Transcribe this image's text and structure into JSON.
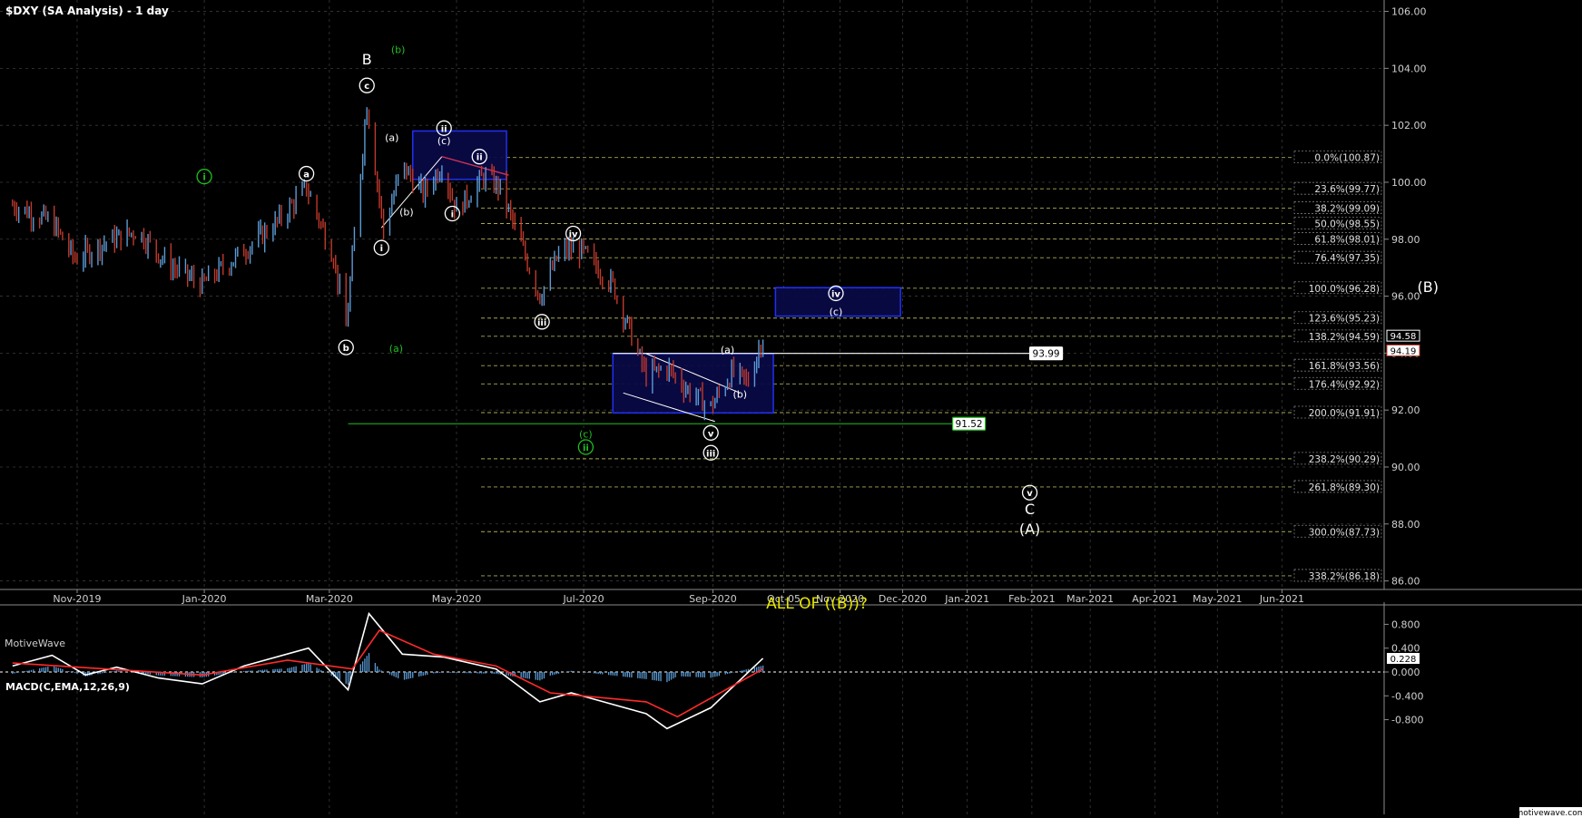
{
  "header": {
    "title": "$DXY (SA Analysis) - 1 day"
  },
  "watermark": "MotiveWave",
  "footer_brand": "motivewave.com",
  "colors": {
    "up": "#5b9bd5",
    "down": "#c0392b",
    "grid": "#3a3a3a",
    "fib": "#a9a957",
    "box_fill": "#0a0a45",
    "box_stroke": "#2233ff",
    "green": "#1fbf1f",
    "annotation": "#e6e600"
  },
  "chart_data": [
    {
      "type": "candlestick",
      "y_ticks": [
        "106.00",
        "104.00",
        "102.00",
        "100.00",
        "98.00",
        "96.00",
        "94.00",
        "92.00",
        "90.00",
        "88.00",
        "86.00"
      ],
      "x_labels": [
        "Nov-2019",
        "Jan-2020",
        "Mar-2020",
        "May-2020",
        "Jul-2020",
        "Sep-2020",
        "Oct-05",
        "Nov-2020",
        "Dec-2020",
        "Jan-2021",
        "Feb-2021",
        "Mar-2021",
        "Apr-2021",
        "May-2021",
        "Jun-2021"
      ],
      "ylim": [
        85.7,
        106.4
      ],
      "price_path": [
        [
          "2019-10-01",
          99.2
        ],
        [
          "2019-10-20",
          98.6
        ],
        [
          "2019-10-31",
          97.3
        ],
        [
          "2019-11-15",
          97.9
        ],
        [
          "2019-11-30",
          98.3
        ],
        [
          "2019-12-15",
          97.1
        ],
        [
          "2019-12-31",
          96.4
        ],
        [
          "2020-01-20",
          97.6
        ],
        [
          "2020-02-05",
          98.6
        ],
        [
          "2020-02-19",
          99.8
        ],
        [
          "2020-03-03",
          97.4
        ],
        [
          "2020-03-09",
          94.9
        ],
        [
          "2020-03-19",
          102.8
        ],
        [
          "2020-03-27",
          98.3
        ],
        [
          "2020-04-05",
          100.6
        ],
        [
          "2020-04-15",
          99.6
        ],
        [
          "2020-04-24",
          100.6
        ],
        [
          "2020-05-01",
          99.0
        ],
        [
          "2020-05-14",
          100.2
        ],
        [
          "2020-05-22",
          99.8
        ],
        [
          "2020-06-10",
          96.0
        ],
        [
          "2020-06-20",
          97.6
        ],
        [
          "2020-06-30",
          97.6
        ],
        [
          "2020-07-15",
          96.4
        ],
        [
          "2020-07-31",
          93.2
        ],
        [
          "2020-08-10",
          93.5
        ],
        [
          "2020-08-20",
          92.7
        ],
        [
          "2020-08-31",
          92.1
        ],
        [
          "2020-09-10",
          93.3
        ],
        [
          "2020-09-18",
          93.0
        ],
        [
          "2020-09-25",
          94.6
        ]
      ],
      "fib_levels": [
        {
          "label": "0.0%(100.87)",
          "price": 100.87
        },
        {
          "label": "23.6%(99.77)",
          "price": 99.77
        },
        {
          "label": "38.2%(99.09)",
          "price": 99.09
        },
        {
          "label": "50.0%(98.55)",
          "price": 98.55
        },
        {
          "label": "61.8%(98.01)",
          "price": 98.01
        },
        {
          "label": "76.4%(97.35)",
          "price": 97.35
        },
        {
          "label": "100.0%(96.28)",
          "price": 96.28
        },
        {
          "label": "123.6%(95.23)",
          "price": 95.23
        },
        {
          "label": "138.2%(94.59)",
          "price": 94.59
        },
        {
          "label": "161.8%(93.56)",
          "price": 93.56
        },
        {
          "label": "176.4%(92.92)",
          "price": 92.92
        },
        {
          "label": "200.0%(91.91)",
          "price": 91.91
        },
        {
          "label": "238.2%(90.29)",
          "price": 90.29
        },
        {
          "label": "261.8%(89.30)",
          "price": 89.3
        },
        {
          "label": "300.0%(87.73)",
          "price": 87.73
        },
        {
          "label": "338.2%(86.18)",
          "price": 86.18
        }
      ],
      "horizontal_lines": [
        {
          "label": "93.99",
          "price": 93.99,
          "start": "2020-07-15",
          "end": "2021-01-31"
        },
        {
          "label": "91.52",
          "price": 91.52,
          "start": "2020-03-10",
          "end": "2020-12-25"
        }
      ],
      "price_tags": [
        {
          "label": "94.58",
          "price": 94.58
        },
        {
          "label": "94.19",
          "price": 94.19
        }
      ],
      "target_boxes": [
        {
          "x0": "2020-04-10",
          "x1": "2020-05-25",
          "y_low": 100.1,
          "y_high": 101.8
        },
        {
          "x0": "2020-07-15",
          "x1": "2020-09-30",
          "y_low": 91.9,
          "y_high": 93.98
        },
        {
          "x0": "2020-10-01",
          "x1": "2020-11-30",
          "y_low": 95.3,
          "y_high": 96.3
        }
      ],
      "wave_labels": [
        {
          "text": "B",
          "style": "plain",
          "color": "white",
          "date": "2020-03-19",
          "price": 104.3
        },
        {
          "text": "c",
          "style": "circle",
          "color": "white",
          "date": "2020-03-19",
          "price": 103.4
        },
        {
          "text": "(b)",
          "style": "plain",
          "color": "green",
          "date": "2020-04-03",
          "price": 104.7
        },
        {
          "text": "i",
          "style": "circle",
          "color": "green",
          "date": "2020-01-01",
          "price": 100.2
        },
        {
          "text": "a",
          "style": "circle",
          "color": "white",
          "date": "2020-02-19",
          "price": 100.3
        },
        {
          "text": "b",
          "style": "circle",
          "color": "white",
          "date": "2020-03-09",
          "price": 94.2
        },
        {
          "text": "(a)",
          "style": "plain",
          "color": "green",
          "date": "2020-04-02",
          "price": 94.2
        },
        {
          "text": "i",
          "style": "circle",
          "color": "white",
          "date": "2020-03-26",
          "price": 97.7
        },
        {
          "text": "(a)",
          "style": "plain",
          "color": "white",
          "date": "2020-03-31",
          "price": 101.6
        },
        {
          "text": "(b)",
          "style": "plain",
          "color": "white",
          "date": "2020-04-07",
          "price": 99.0
        },
        {
          "text": "ii",
          "style": "circle",
          "color": "white",
          "date": "2020-04-25",
          "price": 101.9
        },
        {
          "text": "(c)",
          "style": "plain",
          "color": "white",
          "date": "2020-04-25",
          "price": 101.5
        },
        {
          "text": "ii",
          "style": "circle",
          "color": "white",
          "date": "2020-05-12",
          "price": 100.9
        },
        {
          "text": "i",
          "style": "circle",
          "color": "white",
          "date": "2020-04-29",
          "price": 98.9
        },
        {
          "text": "iii",
          "style": "circle",
          "color": "white",
          "date": "2020-06-11",
          "price": 95.1
        },
        {
          "text": "iv",
          "style": "circle",
          "color": "white",
          "date": "2020-06-26",
          "price": 98.2
        },
        {
          "text": "iv",
          "style": "circle",
          "color": "white",
          "date": "2020-10-30",
          "price": 96.1
        },
        {
          "text": "(c)",
          "style": "plain",
          "color": "white",
          "date": "2020-10-30",
          "price": 95.5
        },
        {
          "text": "(a)",
          "style": "plain",
          "color": "white",
          "date": "2020-09-08",
          "price": 94.15
        },
        {
          "text": "(b)",
          "style": "plain",
          "color": "white",
          "date": "2020-09-14",
          "price": 92.6
        },
        {
          "text": "v",
          "style": "circle",
          "color": "white",
          "date": "2020-08-31",
          "price": 91.2
        },
        {
          "text": "iii",
          "style": "circle",
          "color": "white",
          "date": "2020-08-31",
          "price": 90.5
        },
        {
          "text": "(c)",
          "style": "plain",
          "color": "green",
          "date": "2020-07-02",
          "price": 91.2
        },
        {
          "text": "ii",
          "style": "circle",
          "color": "green",
          "date": "2020-07-02",
          "price": 90.7
        },
        {
          "text": "v",
          "style": "circle",
          "color": "white",
          "date": "2021-01-31",
          "price": 89.1
        },
        {
          "text": "C",
          "style": "plain",
          "color": "white",
          "date": "2021-01-31",
          "price": 88.5
        },
        {
          "text": "(A)",
          "style": "plain",
          "color": "white",
          "date": "2021-01-31",
          "price": 87.8
        },
        {
          "text": "(B)",
          "style": "plain",
          "color": "white",
          "date": "2021-08-10",
          "price": 96.3
        }
      ],
      "annotation": "ALL OF ((B))?"
    },
    {
      "type": "line",
      "title": "MACD(C,EMA,12,26,9)",
      "y_ticks": [
        "0.800",
        "0.400",
        "0.000",
        "-0.400",
        "-0.800"
      ],
      "ylim": [
        -1.05,
        1.05
      ],
      "value_tag": "0.228",
      "series": [
        {
          "name": "MACD",
          "color": "#ffffff",
          "points": [
            [
              "2019-10-01",
              0.1
            ],
            [
              "2019-10-20",
              0.28
            ],
            [
              "2019-11-05",
              -0.05
            ],
            [
              "2019-11-20",
              0.08
            ],
            [
              "2019-12-10",
              -0.1
            ],
            [
              "2019-12-31",
              -0.2
            ],
            [
              "2020-01-20",
              0.1
            ],
            [
              "2020-02-20",
              0.4
            ],
            [
              "2020-03-10",
              -0.3
            ],
            [
              "2020-03-20",
              0.98
            ],
            [
              "2020-04-05",
              0.3
            ],
            [
              "2020-04-25",
              0.25
            ],
            [
              "2020-05-20",
              0.05
            ],
            [
              "2020-06-10",
              -0.5
            ],
            [
              "2020-06-25",
              -0.35
            ],
            [
              "2020-07-31",
              -0.7
            ],
            [
              "2020-08-10",
              -0.95
            ],
            [
              "2020-08-31",
              -0.6
            ],
            [
              "2020-09-25",
              0.23
            ]
          ]
        },
        {
          "name": "Signal",
          "color": "#ff2a2a",
          "points": [
            [
              "2019-10-01",
              0.15
            ],
            [
              "2019-11-15",
              0.05
            ],
            [
              "2019-12-31",
              -0.05
            ],
            [
              "2020-02-10",
              0.2
            ],
            [
              "2020-03-12",
              0.05
            ],
            [
              "2020-03-25",
              0.7
            ],
            [
              "2020-04-20",
              0.3
            ],
            [
              "2020-05-20",
              0.1
            ],
            [
              "2020-06-15",
              -0.35
            ],
            [
              "2020-07-31",
              -0.5
            ],
            [
              "2020-08-15",
              -0.75
            ],
            [
              "2020-09-25",
              0.05
            ]
          ]
        }
      ]
    }
  ]
}
